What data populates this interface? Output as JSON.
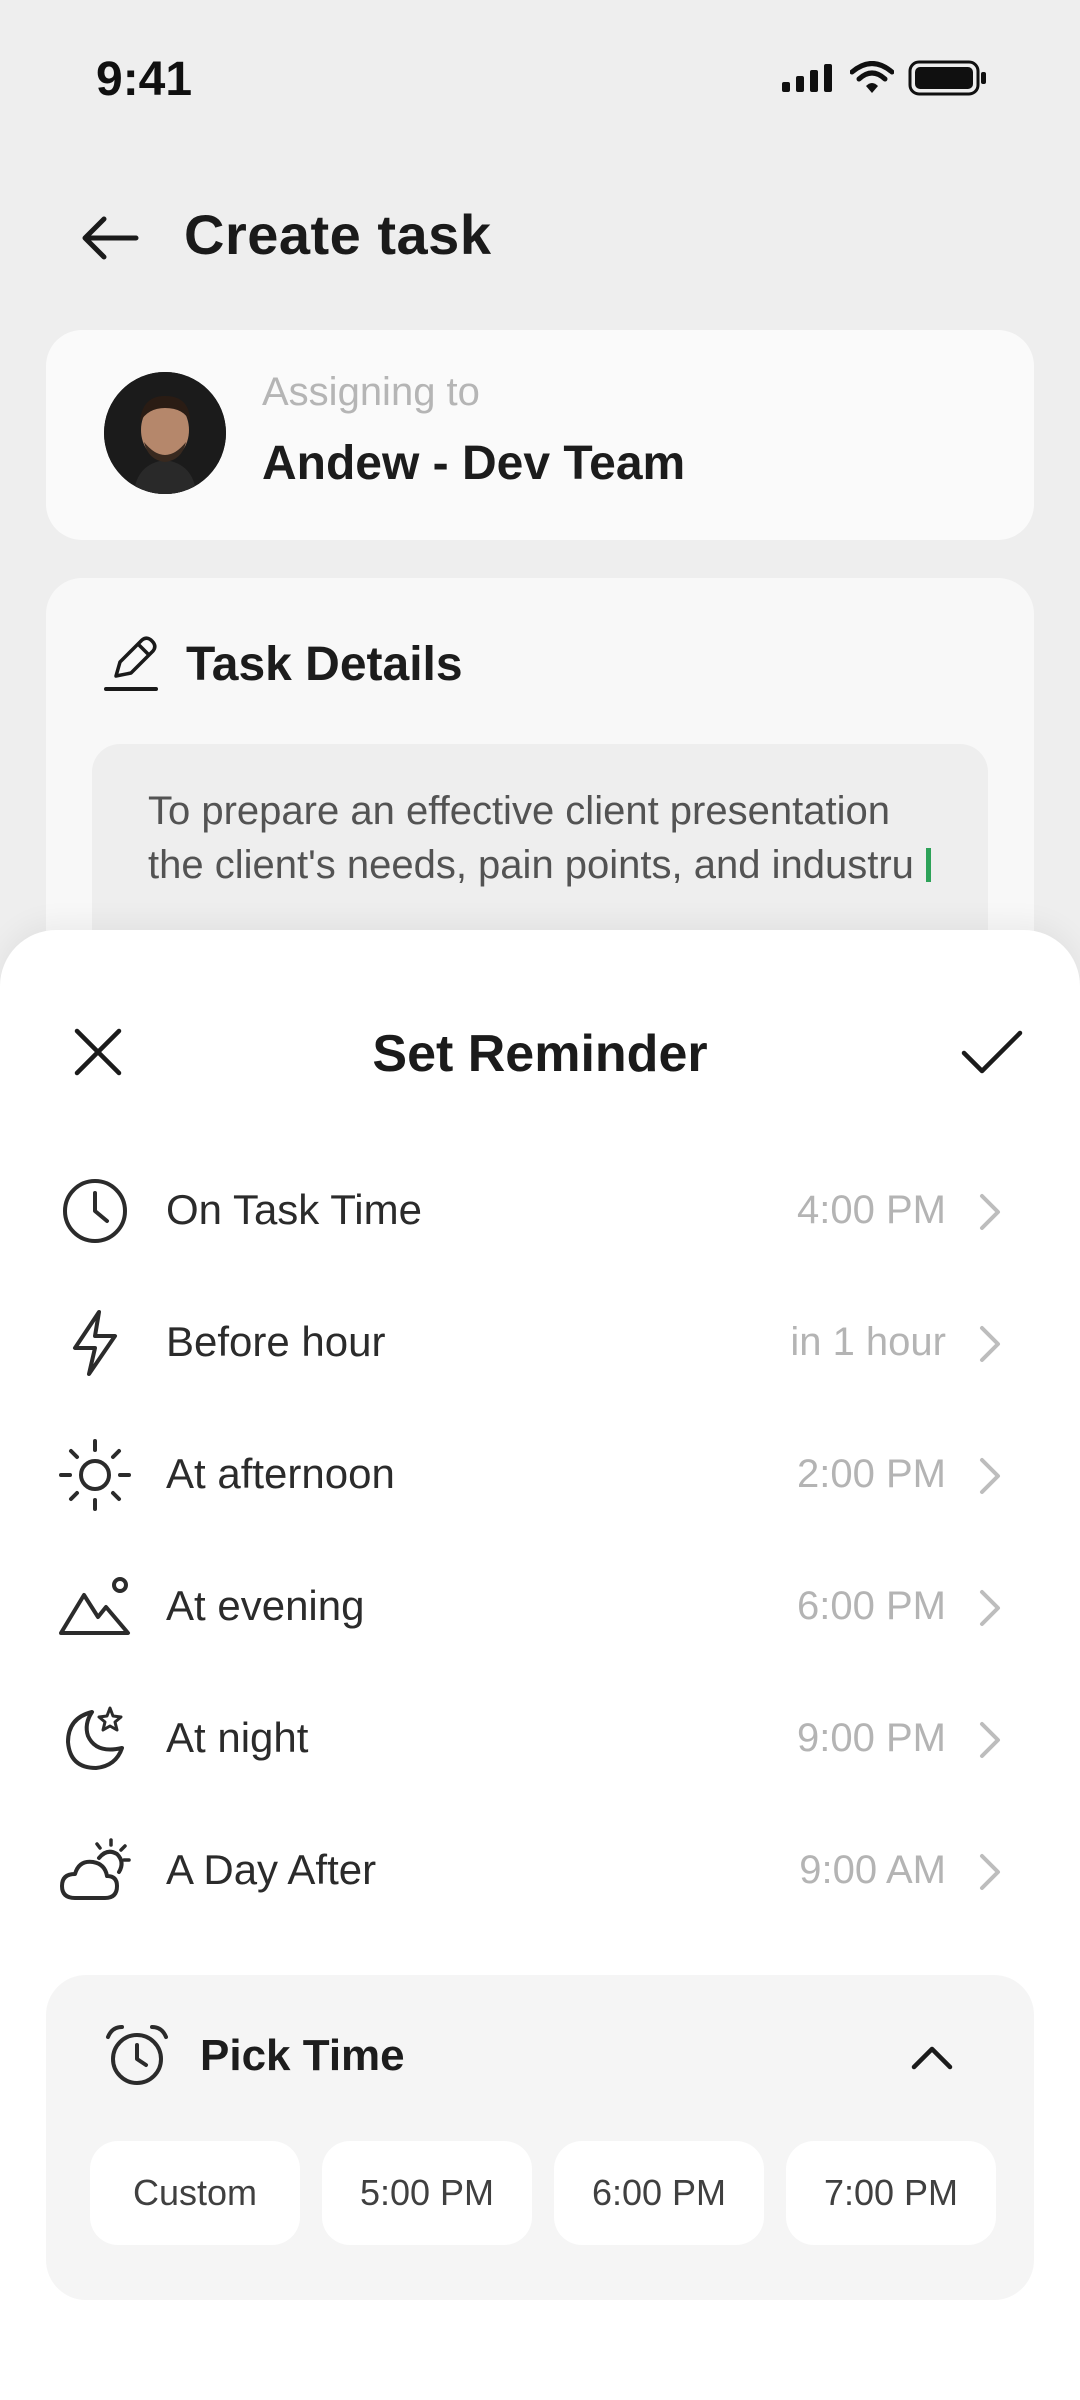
{
  "status_bar": {
    "time": "9:41"
  },
  "header": {
    "title": "Create task"
  },
  "assignee": {
    "label": "Assigning to",
    "name": "Andew - Dev Team"
  },
  "task_details": {
    "title": "Task Details",
    "text": "To prepare an effective client presentation the client's needs, pain points, and industru"
  },
  "reminder_sheet": {
    "title": "Set Reminder",
    "options": [
      {
        "icon": "clock-icon",
        "label": "On Task Time",
        "value": "4:00 PM"
      },
      {
        "icon": "lightning-icon",
        "label": "Before hour",
        "value": "in 1 hour"
      },
      {
        "icon": "sun-icon",
        "label": "At afternoon",
        "value": "2:00 PM"
      },
      {
        "icon": "mountain-icon",
        "label": "At evening",
        "value": "6:00 PM"
      },
      {
        "icon": "moon-star-icon",
        "label": "At night",
        "value": "9:00 PM"
      },
      {
        "icon": "cloud-sun-icon",
        "label": "A Day After",
        "value": "9:00 AM"
      }
    ],
    "pick_time": {
      "title": "Pick Time",
      "chips": [
        "Custom",
        "5:00 PM",
        "6:00 PM",
        "7:00 PM"
      ]
    }
  },
  "colors": {
    "accent_caret": "#2ea65a",
    "background": "#f3f3f3",
    "muted_text": "#b4b4b4"
  }
}
